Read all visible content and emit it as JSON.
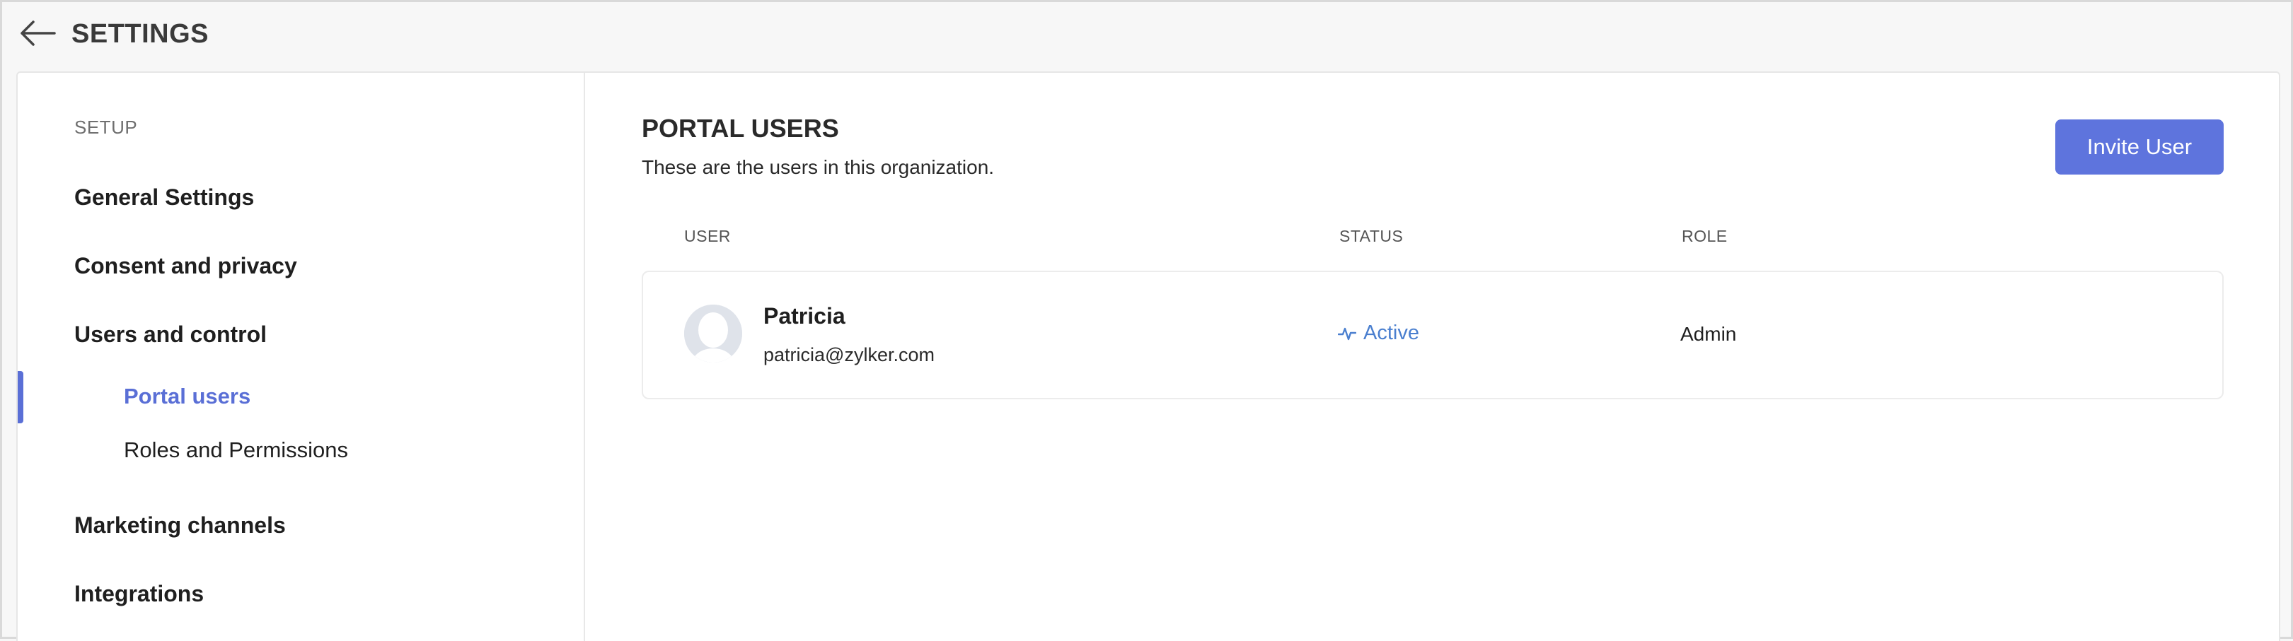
{
  "header": {
    "title": "SETTINGS",
    "back_icon": "arrow-left-icon"
  },
  "sidebar": {
    "section": "SETUP",
    "items": [
      {
        "label": "General Settings"
      },
      {
        "label": "Consent and privacy"
      },
      {
        "label": "Users and control"
      },
      {
        "label": "Marketing channels"
      },
      {
        "label": "Integrations"
      }
    ],
    "subitems": [
      {
        "label": "Portal users",
        "active": true
      },
      {
        "label": "Roles and Permissions",
        "active": false
      }
    ]
  },
  "main": {
    "title": "PORTAL USERS",
    "subtitle": "These are the users in this organization.",
    "invite_label": "Invite User",
    "columns": {
      "user": "USER",
      "status": "STATUS",
      "role": "ROLE"
    },
    "users": [
      {
        "name": "Patricia",
        "email": "patricia@zylker.com",
        "status": "Active",
        "role": "Admin"
      }
    ]
  },
  "colors": {
    "accent": "#5e74dd",
    "active_link": "#5a6fd6",
    "status_active": "#4a7fcf"
  }
}
